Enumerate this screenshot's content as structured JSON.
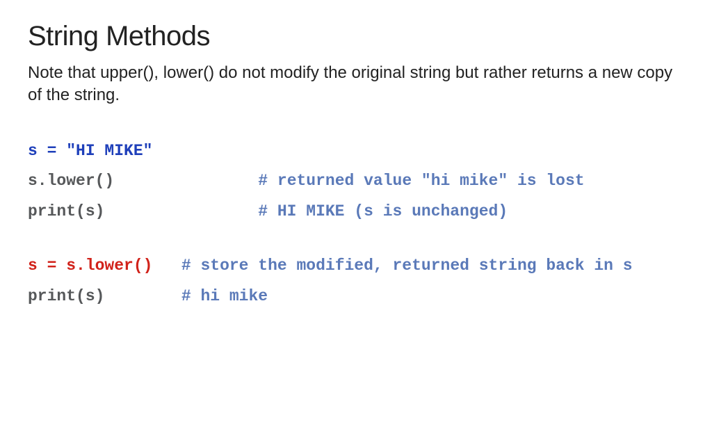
{
  "title": "String Methods",
  "note": "Note that upper(), lower() do not modify the original string but rather returns a new copy of the string.",
  "code": {
    "l1": "s = \"HI MIKE\"",
    "l2a": "s.lower()",
    "l2b": "# returned value \"hi mike\" is lost",
    "l3a": "print(s)",
    "l3b": "# HI MIKE (s is unchanged)",
    "l4a": "s = s.lower()",
    "l4b": "# store the modified, returned string back in s",
    "l5a": "print(s)",
    "l5b": "# hi mike"
  }
}
